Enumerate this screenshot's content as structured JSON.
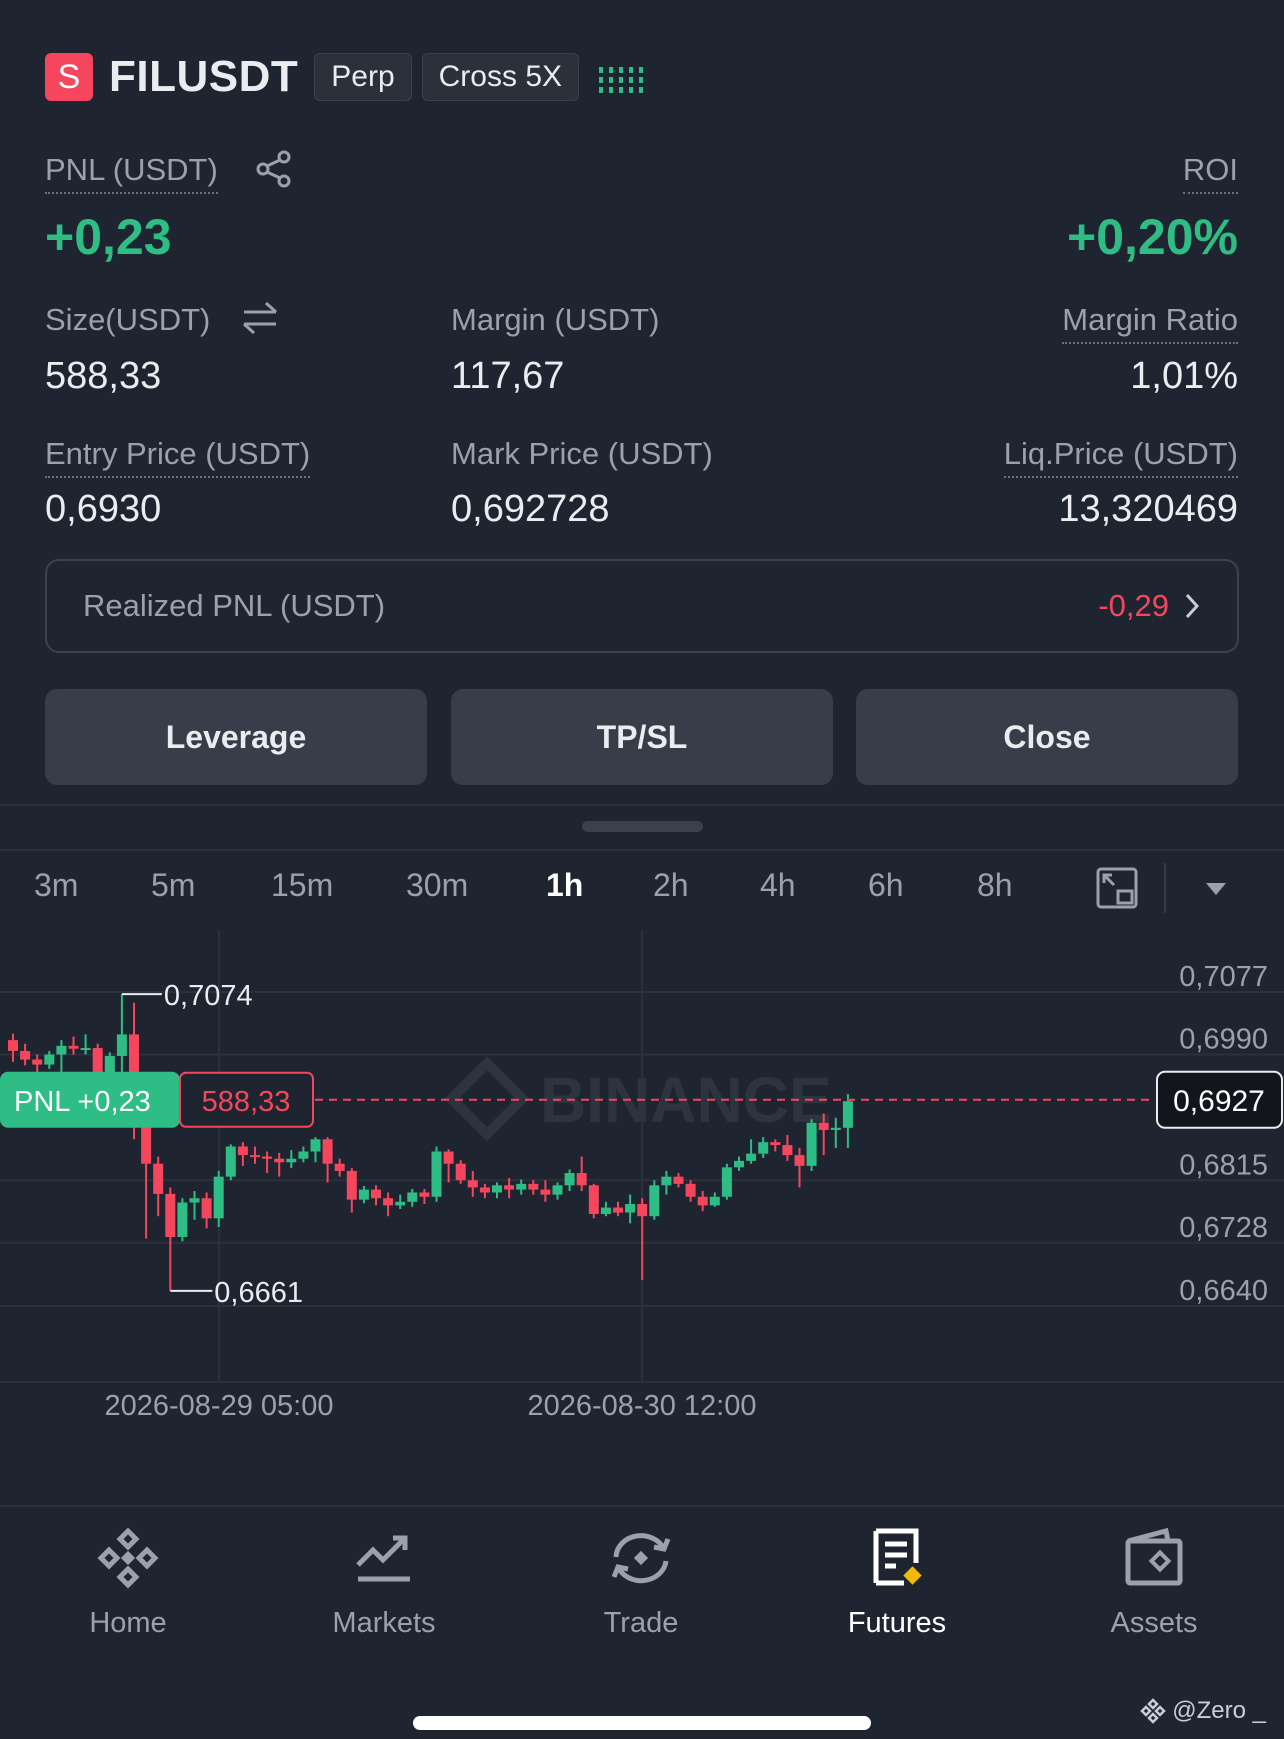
{
  "header": {
    "badge": "S",
    "symbol": "FILUSDT",
    "tag_perp": "Perp",
    "tag_margin": "Cross 5X"
  },
  "stats": {
    "pnl_label": "PNL (USDT)",
    "pnl_value": "+0,23",
    "roi_label": "ROI",
    "roi_value": "+0,20%",
    "size_label": "Size(USDT)",
    "size_value": "588,33",
    "margin_label": "Margin (USDT)",
    "margin_value": "117,67",
    "margin_ratio_label": "Margin Ratio",
    "margin_ratio_value": "1,01%",
    "entry_label": "Entry Price (USDT)",
    "entry_value": "0,6930",
    "mark_label": "Mark Price (USDT)",
    "mark_value": "0,692728",
    "liq_label": "Liq.Price (USDT)",
    "liq_value": "13,320469"
  },
  "realized": {
    "label": "Realized PNL (USDT)",
    "value": "-0,29"
  },
  "actions": {
    "leverage": "Leverage",
    "tpsl": "TP/SL",
    "close": "Close"
  },
  "intervals": [
    "3m",
    "5m",
    "15m",
    "30m",
    "1h",
    "2h",
    "4h",
    "6h",
    "8h"
  ],
  "active_interval": "1h",
  "chart_data": {
    "type": "candlestick",
    "y_ticks": [
      "0,7077",
      "0,6990",
      "0,6927",
      "0,6815",
      "0,6728",
      "0,6640"
    ],
    "x_ticks": [
      "2026-08-29 05:00",
      "2026-08-30 12:00"
    ],
    "high_label": "0,7074",
    "low_label": "0,6661",
    "current_price": "0,6927",
    "position_pnl_label": "PNL +0,23",
    "position_size_label": "588,33",
    "watermark": "BINANCE",
    "ylim": [
      0.664,
      0.7077
    ],
    "candles": [
      [
        0.701,
        0.6995,
        0.7019,
        0.698
      ],
      [
        0.6995,
        0.6983,
        0.7005,
        0.6975
      ],
      [
        0.6983,
        0.6976,
        0.699,
        0.6965
      ],
      [
        0.6976,
        0.699,
        0.6995,
        0.697
      ],
      [
        0.699,
        0.7002,
        0.701,
        0.6935
      ],
      [
        0.7002,
        0.6998,
        0.7015,
        0.699
      ],
      [
        0.6998,
        0.6999,
        0.7018,
        0.699
      ],
      [
        0.6999,
        0.6962,
        0.7005,
        0.6955
      ],
      [
        0.6962,
        0.6988,
        0.6993,
        0.695
      ],
      [
        0.6988,
        0.7018,
        0.7074,
        0.6932
      ],
      [
        0.7018,
        0.69,
        0.7062,
        0.6872
      ],
      [
        0.69,
        0.6838,
        0.6905,
        0.6734
      ],
      [
        0.6838,
        0.6796,
        0.6848,
        0.6765
      ],
      [
        0.6796,
        0.6736,
        0.6805,
        0.6661
      ],
      [
        0.6736,
        0.6784,
        0.679,
        0.673
      ],
      [
        0.6784,
        0.679,
        0.68,
        0.676
      ],
      [
        0.679,
        0.6762,
        0.6798,
        0.6748
      ],
      [
        0.6762,
        0.682,
        0.6828,
        0.675
      ],
      [
        0.682,
        0.6862,
        0.6865,
        0.6815
      ],
      [
        0.6862,
        0.685,
        0.6868,
        0.6835
      ],
      [
        0.685,
        0.6848,
        0.6862,
        0.6838
      ],
      [
        0.6848,
        0.6845,
        0.6855,
        0.6825
      ],
      [
        0.6845,
        0.684,
        0.6853,
        0.682
      ],
      [
        0.684,
        0.6845,
        0.6857,
        0.6832
      ],
      [
        0.6845,
        0.6855,
        0.6862,
        0.684
      ],
      [
        0.6855,
        0.6872,
        0.6875,
        0.684
      ],
      [
        0.6872,
        0.6838,
        0.6875,
        0.6812
      ],
      [
        0.6838,
        0.6828,
        0.6845,
        0.682
      ],
      [
        0.6828,
        0.6788,
        0.6832,
        0.677
      ],
      [
        0.6788,
        0.6802,
        0.6807,
        0.6783
      ],
      [
        0.6802,
        0.679,
        0.6808,
        0.678
      ],
      [
        0.679,
        0.678,
        0.6798,
        0.6765
      ],
      [
        0.678,
        0.6785,
        0.6795,
        0.6775
      ],
      [
        0.6785,
        0.6798,
        0.6803,
        0.6778
      ],
      [
        0.6798,
        0.6792,
        0.6803,
        0.6782
      ],
      [
        0.6792,
        0.6855,
        0.6862,
        0.6785
      ],
      [
        0.6855,
        0.6838,
        0.6858,
        0.6812
      ],
      [
        0.6838,
        0.6815,
        0.6843,
        0.681
      ],
      [
        0.6815,
        0.6805,
        0.6828,
        0.6792
      ],
      [
        0.6805,
        0.6798,
        0.681,
        0.679
      ],
      [
        0.6798,
        0.6808,
        0.6812,
        0.679
      ],
      [
        0.6808,
        0.6802,
        0.6818,
        0.679
      ],
      [
        0.6802,
        0.681,
        0.6816,
        0.6795
      ],
      [
        0.681,
        0.6802,
        0.6815,
        0.6795
      ],
      [
        0.6802,
        0.6795,
        0.6815,
        0.6785
      ],
      [
        0.6795,
        0.6808,
        0.6812,
        0.6788
      ],
      [
        0.6808,
        0.6825,
        0.683,
        0.68
      ],
      [
        0.6825,
        0.6808,
        0.6848,
        0.68
      ],
      [
        0.6808,
        0.6768,
        0.681,
        0.6762
      ],
      [
        0.6768,
        0.6777,
        0.6785,
        0.6765
      ],
      [
        0.6777,
        0.677,
        0.6785,
        0.6765
      ],
      [
        0.677,
        0.6782,
        0.6795,
        0.6755
      ],
      [
        0.6782,
        0.6765,
        0.679,
        0.6676
      ],
      [
        0.6765,
        0.6808,
        0.6815,
        0.676
      ],
      [
        0.6808,
        0.682,
        0.6828,
        0.6795
      ],
      [
        0.682,
        0.681,
        0.6825,
        0.6805
      ],
      [
        0.681,
        0.6792,
        0.6815,
        0.6785
      ],
      [
        0.6792,
        0.678,
        0.68,
        0.6772
      ],
      [
        0.678,
        0.6792,
        0.6798,
        0.6778
      ],
      [
        0.6792,
        0.6833,
        0.6838,
        0.6788
      ],
      [
        0.6833,
        0.6842,
        0.6848,
        0.6828
      ],
      [
        0.6842,
        0.6852,
        0.6872,
        0.6838
      ],
      [
        0.6852,
        0.6868,
        0.6875,
        0.6846
      ],
      [
        0.6868,
        0.6864,
        0.6872,
        0.6855
      ],
      [
        0.6864,
        0.685,
        0.6878,
        0.6842
      ],
      [
        0.685,
        0.6835,
        0.686,
        0.6805
      ],
      [
        0.6835,
        0.6895,
        0.69,
        0.6828
      ],
      [
        0.6895,
        0.6885,
        0.6908,
        0.685
      ],
      [
        0.6885,
        0.6888,
        0.6902,
        0.686
      ],
      [
        0.6888,
        0.6925,
        0.6935,
        0.686
      ]
    ]
  },
  "nav": [
    {
      "label": "Home",
      "icon": "binance-logo-icon"
    },
    {
      "label": "Markets",
      "icon": "chart-trend-icon"
    },
    {
      "label": "Trade",
      "icon": "swap-arrows-icon"
    },
    {
      "label": "Futures",
      "icon": "futures-document-icon"
    },
    {
      "label": "Assets",
      "icon": "wallet-icon"
    }
  ],
  "active_nav": "Futures",
  "watermark_user": "@Zero _",
  "colors": {
    "background": "#1f2530",
    "up": "#2ebd85",
    "down": "#f6465d",
    "accent": "#f0b90b"
  }
}
